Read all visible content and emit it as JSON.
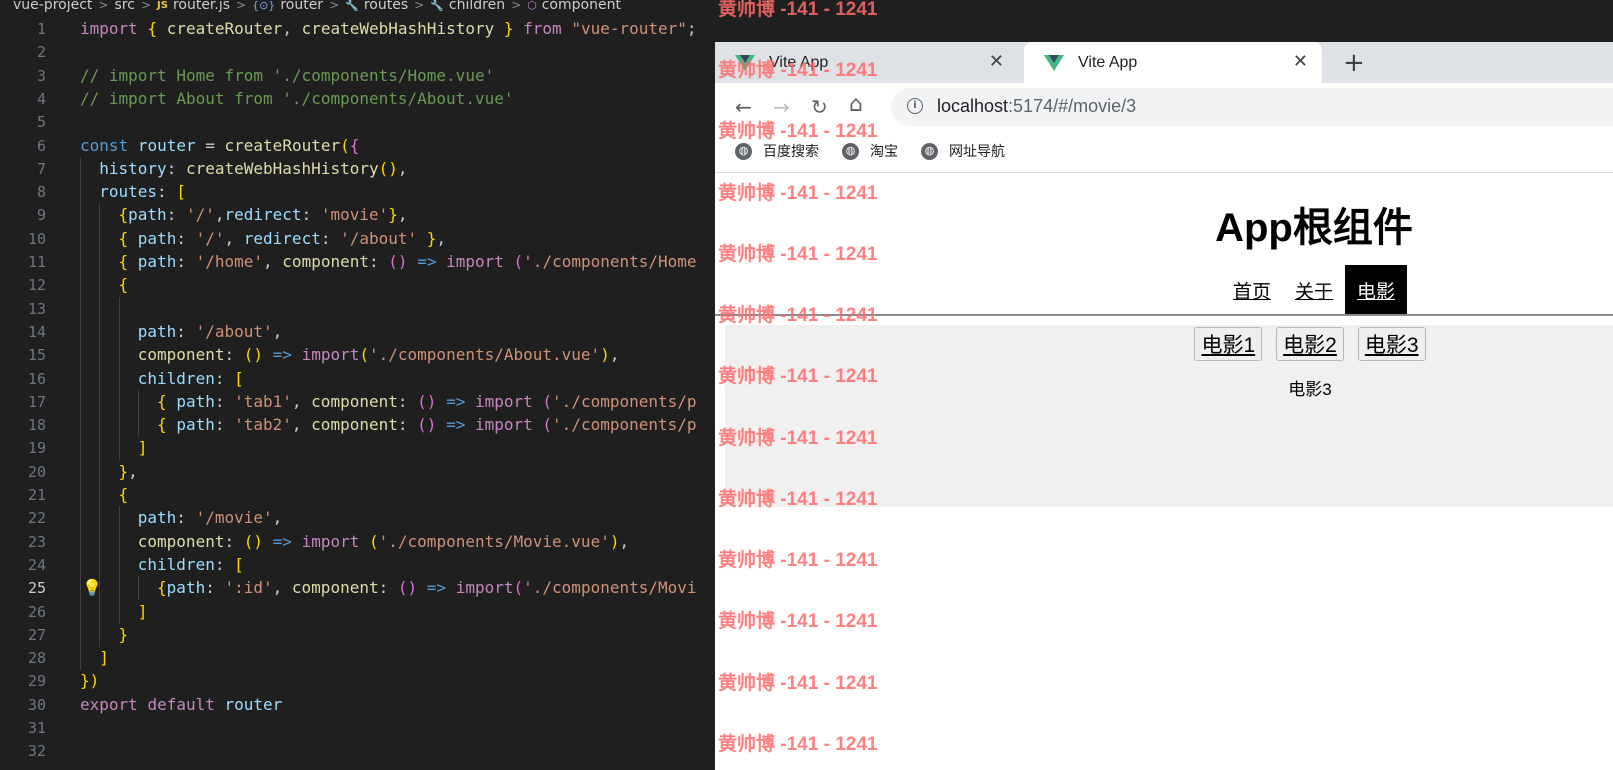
{
  "editor": {
    "breadcrumb": [
      "vue-project",
      "src",
      "router.js",
      "router",
      "routes",
      "children",
      "component"
    ],
    "breadcrumb_icons": [
      "js-file-icon",
      "object-icon",
      "wrench-icon",
      "wrench-icon",
      "cube-icon"
    ],
    "active_line": 25,
    "lines": [
      {
        "n": 1,
        "text": "import { createRouter, createWebHashHistory } from \"vue-router\";"
      },
      {
        "n": 2,
        "text": ""
      },
      {
        "n": 3,
        "text": "// import Home from './components/Home.vue'"
      },
      {
        "n": 4,
        "text": "// import About from './components/About.vue'"
      },
      {
        "n": 5,
        "text": ""
      },
      {
        "n": 6,
        "text": "const router = createRouter({"
      },
      {
        "n": 7,
        "text": "history: createWebHashHistory(),"
      },
      {
        "n": 8,
        "text": "routes: ["
      },
      {
        "n": 9,
        "text": "{path: '/',redirect: 'movie'},"
      },
      {
        "n": 10,
        "text": "{ path: '/', redirect: '/about' },"
      },
      {
        "n": 11,
        "text": "{ path: '/home', component: () => import ('./components/Home"
      },
      {
        "n": 12,
        "text": "{"
      },
      {
        "n": 13,
        "text": ""
      },
      {
        "n": 14,
        "text": "path: '/about',"
      },
      {
        "n": 15,
        "text": "component: () => import('./components/About.vue'),"
      },
      {
        "n": 16,
        "text": "children: ["
      },
      {
        "n": 17,
        "text": "{ path: 'tab1', component: () => import ('./components/p"
      },
      {
        "n": 18,
        "text": "{ path: 'tab2', component: () => import ('./components/p"
      },
      {
        "n": 19,
        "text": "]"
      },
      {
        "n": 20,
        "text": "},"
      },
      {
        "n": 21,
        "text": "{"
      },
      {
        "n": 22,
        "text": "path: '/movie',"
      },
      {
        "n": 23,
        "text": "component: () => import ('./components/Movie.vue'),"
      },
      {
        "n": 24,
        "text": "children: ["
      },
      {
        "n": 25,
        "text": "{path: ':id', component: () => import('./components/Movi"
      },
      {
        "n": 26,
        "text": "]"
      },
      {
        "n": 27,
        "text": "}"
      },
      {
        "n": 28,
        "text": "]"
      },
      {
        "n": 29,
        "text": "})"
      },
      {
        "n": 30,
        "text": "export default router"
      },
      {
        "n": 31,
        "text": ""
      },
      {
        "n": 32,
        "text": ""
      }
    ]
  },
  "browser": {
    "tabs": [
      {
        "title": "Vite App",
        "active": false
      },
      {
        "title": "Vite App",
        "active": true
      }
    ],
    "close_glyph": "✕",
    "new_tab_glyph": "+",
    "nav": {
      "back": "←",
      "forward": "→",
      "reload": "↻",
      "home": "⌂"
    },
    "url_host": "localhost",
    "url_rest": ":5174/#/movie/3",
    "bookmarks": [
      "百度搜索",
      "淘宝",
      "网址导航"
    ]
  },
  "page": {
    "title": "App根组件",
    "nav_links": [
      {
        "label": "首页",
        "active": false
      },
      {
        "label": "关于",
        "active": false
      },
      {
        "label": "电影",
        "active": true
      }
    ],
    "movie_links": [
      "电影1",
      "电影2",
      "电影3"
    ],
    "movie_content": "电影3"
  },
  "watermark": {
    "text": "黄帅博 -141 - 1241",
    "color": "#ff6b6b"
  }
}
